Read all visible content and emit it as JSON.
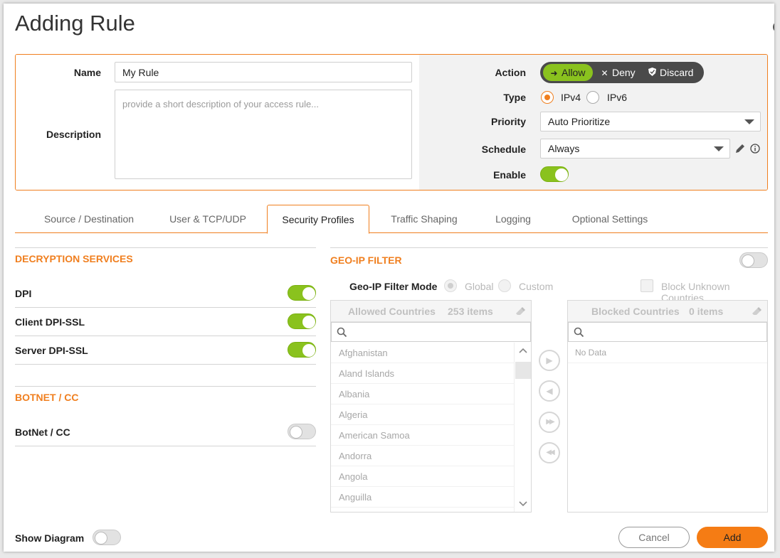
{
  "title": "Adding Rule",
  "general": {
    "name_label": "Name",
    "name_value": "My Rule",
    "description_label": "Description",
    "description_placeholder": "provide a short description of your access rule...",
    "action_label": "Action",
    "actions": [
      {
        "label": "Allow",
        "icon": "arrow-right-icon",
        "selected": true
      },
      {
        "label": "Deny",
        "icon": "x-icon",
        "selected": false
      },
      {
        "label": "Discard",
        "icon": "shield-icon",
        "selected": false
      }
    ],
    "type_label": "Type",
    "types": [
      {
        "label": "IPv4",
        "selected": true
      },
      {
        "label": "IPv6",
        "selected": false
      }
    ],
    "priority_label": "Priority",
    "priority_value": "Auto Prioritize",
    "schedule_label": "Schedule",
    "schedule_value": "Always",
    "enable_label": "Enable",
    "enabled": true
  },
  "tabs": [
    {
      "label": "Source / Destination",
      "active": false
    },
    {
      "label": "User & TCP/UDP",
      "active": false
    },
    {
      "label": "Security Profiles",
      "active": true
    },
    {
      "label": "Traffic Shaping",
      "active": false
    },
    {
      "label": "Logging",
      "active": false
    },
    {
      "label": "Optional Settings",
      "active": false
    }
  ],
  "decryption": {
    "title": "DECRYPTION SERVICES",
    "items": [
      {
        "label": "DPI",
        "enabled": true
      },
      {
        "label": "Client DPI-SSL",
        "enabled": true
      },
      {
        "label": "Server DPI-SSL",
        "enabled": true
      }
    ]
  },
  "botnet": {
    "title": "BOTNET / CC",
    "items": [
      {
        "label": "BotNet / CC",
        "enabled": false
      }
    ]
  },
  "geoip": {
    "title": "GEO-IP FILTER",
    "enabled": false,
    "mode_label": "Geo-IP Filter Mode",
    "modes": [
      {
        "label": "Global",
        "selected": true
      },
      {
        "label": "Custom",
        "selected": false
      }
    ],
    "block_unknown_label": "Block Unknown Countries",
    "allowed": {
      "title": "Allowed Countries",
      "count": "253 items",
      "items": [
        "Afghanistan",
        "Aland Islands",
        "Albania",
        "Algeria",
        "American Samoa",
        "Andorra",
        "Angola",
        "Anguilla"
      ]
    },
    "blocked": {
      "title": "Blocked Countries",
      "count": "0 items",
      "empty_text": "No Data"
    }
  },
  "footer": {
    "show_diagram_label": "Show Diagram",
    "show_diagram": false,
    "cancel_label": "Cancel",
    "add_label": "Add"
  },
  "colors": {
    "accent": "#f07f1f",
    "toggle_on": "#8ac21e",
    "add_button": "#f57c14"
  }
}
